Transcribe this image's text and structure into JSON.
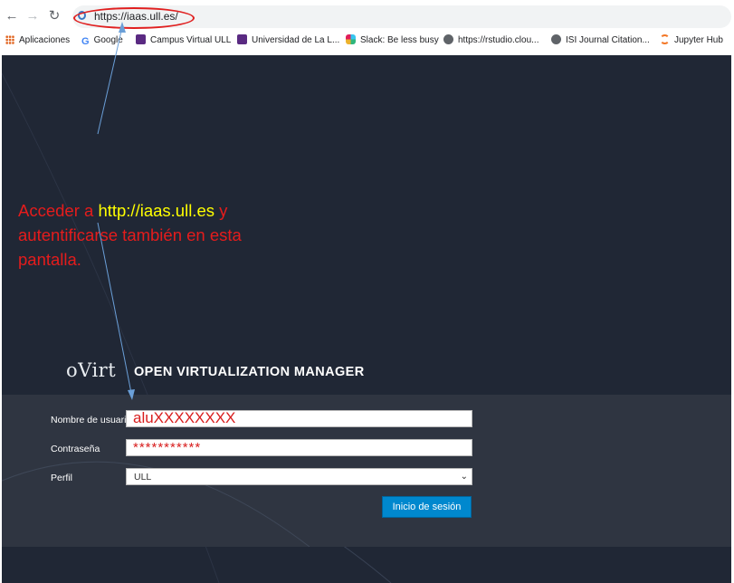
{
  "browser": {
    "url": "https://iaas.ull.es/",
    "bookmarks": [
      {
        "label": "Aplicaciones",
        "icon": "apps-grid-icon"
      },
      {
        "label": "Google",
        "icon": "google-icon"
      },
      {
        "label": "Campus Virtual ULL",
        "icon": "campus-virtual-icon"
      },
      {
        "label": "Universidad de La L...",
        "icon": "universidad-icon"
      },
      {
        "label": "Slack: Be less busy",
        "icon": "slack-icon"
      },
      {
        "label": "https://rstudio.clou...",
        "icon": "globe-icon"
      },
      {
        "label": "ISI Journal Citation...",
        "icon": "globe-icon"
      },
      {
        "label": "Jupyter Hub",
        "icon": "jupyter-icon"
      }
    ]
  },
  "annotation": {
    "line1_prefix": "Acceder a ",
    "line1_link": "http://iaas.ull.es",
    "line1_suffix": " y",
    "line2": "autentificarse también en esta",
    "line3": "pantalla.",
    "color": "#e51c1c",
    "highlight_color": "#ffff00"
  },
  "login": {
    "logo": "oVirt",
    "title": "OPEN VIRTUALIZATION MANAGER",
    "username_label": "Nombre de usuario",
    "username_value": "aluXXXXXXXX",
    "password_label": "Contraseña",
    "password_value": "***********",
    "profile_label": "Perfil",
    "profile_value": "ULL",
    "submit_label": "Inicio de sesión",
    "accent": "#0088ce",
    "background": "#202735"
  }
}
